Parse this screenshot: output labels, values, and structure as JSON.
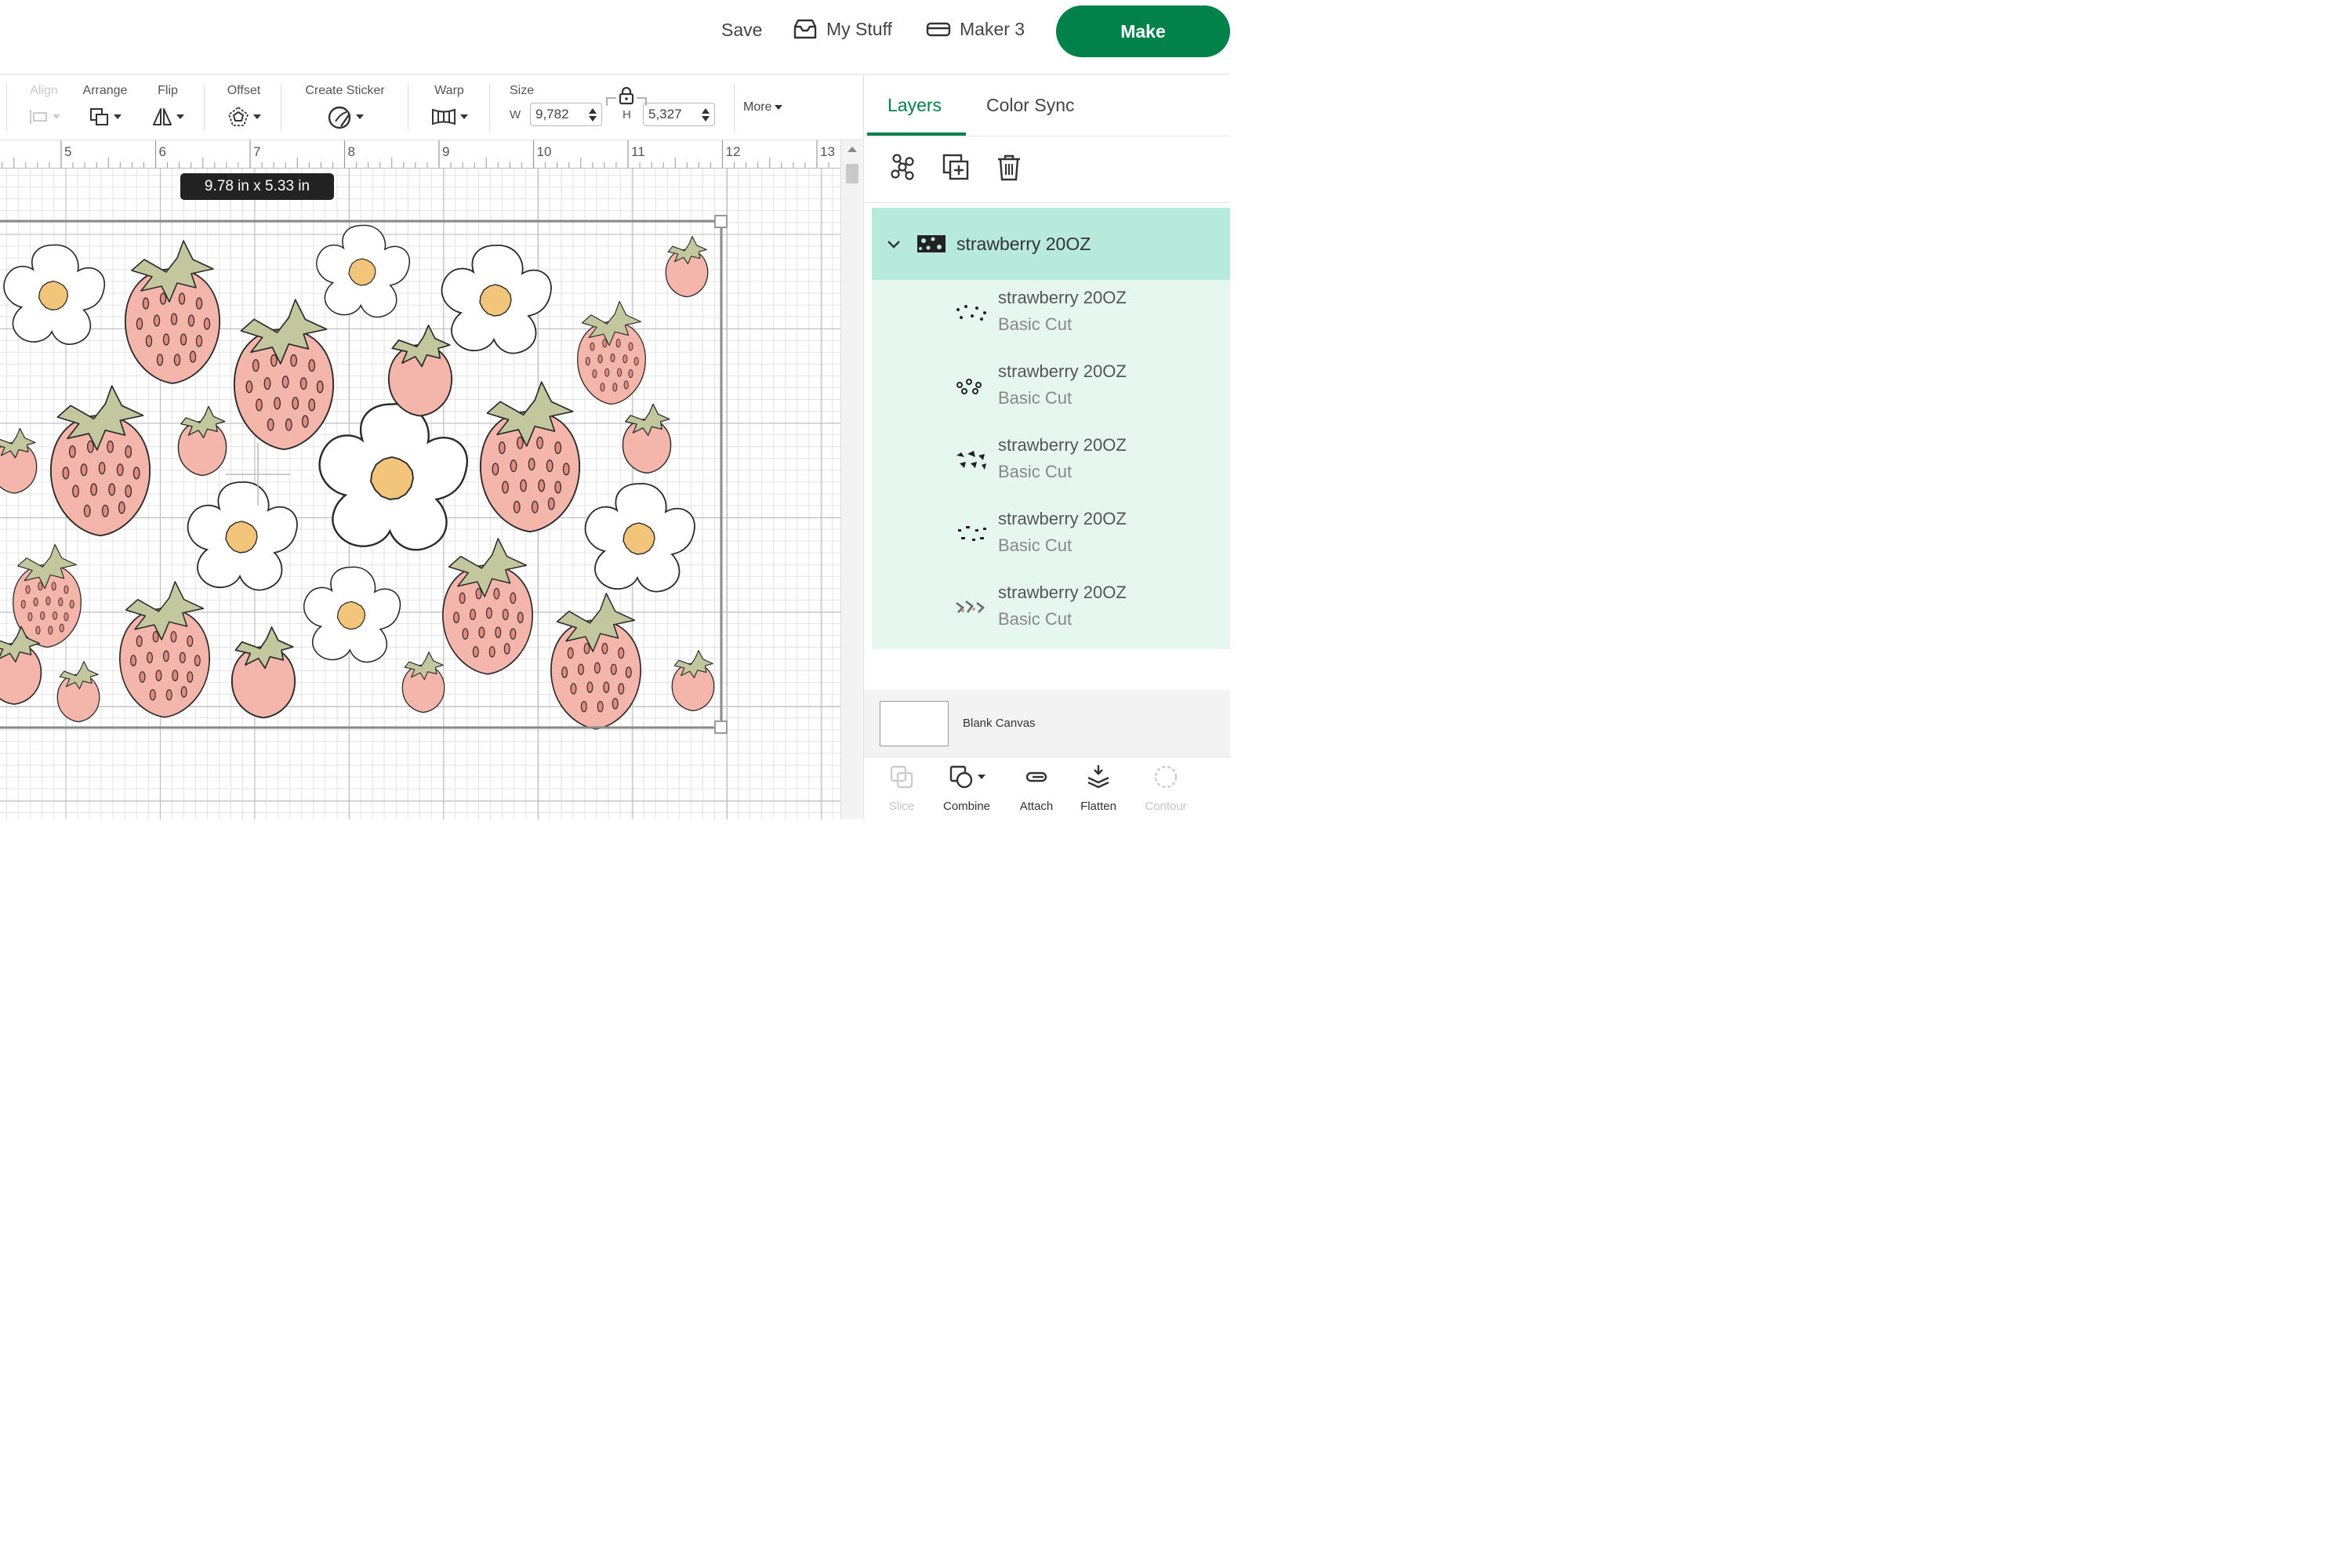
{
  "header": {
    "save_label": "Save",
    "mystuff_label": "My Stuff",
    "machine_label": "Maker 3",
    "make_label": "Make",
    "accent_color": "#00824a"
  },
  "toolbar": {
    "align_label": "Align",
    "arrange_label": "Arrange",
    "flip_label": "Flip",
    "offset_label": "Offset",
    "sticker_label": "Create Sticker",
    "warp_label": "Warp",
    "size_label": "Size",
    "width_key": "W",
    "width_value": "9,782",
    "height_key": "H",
    "height_value": "5,327",
    "more_label": "More"
  },
  "canvas": {
    "ruler_ticks": [
      "5",
      "6",
      "7",
      "8",
      "9",
      "10",
      "11",
      "12",
      "13"
    ],
    "dimension_tag": "9.78  in x 5.33  in",
    "colors": {
      "strawberry": "#f4b5ab",
      "leaf": "#c3c79d",
      "flower_center": "#f2c57b",
      "outline": "#2a2a2a"
    }
  },
  "panel": {
    "tabs": [
      "Layers",
      "Color Sync"
    ],
    "active_tab": "Layers",
    "group": {
      "name": "strawberry 20OZ",
      "layers": [
        {
          "name": "strawberry 20OZ",
          "type": "Basic Cut"
        },
        {
          "name": "strawberry 20OZ",
          "type": "Basic Cut"
        },
        {
          "name": "strawberry 20OZ",
          "type": "Basic Cut"
        },
        {
          "name": "strawberry 20OZ",
          "type": "Basic Cut"
        },
        {
          "name": "strawberry 20OZ",
          "type": "Basic Cut"
        }
      ]
    },
    "blank_canvas_label": "Blank Canvas",
    "bottom_tools": {
      "slice": "Slice",
      "combine": "Combine",
      "attach": "Attach",
      "flatten": "Flatten",
      "contour": "Contour"
    }
  }
}
